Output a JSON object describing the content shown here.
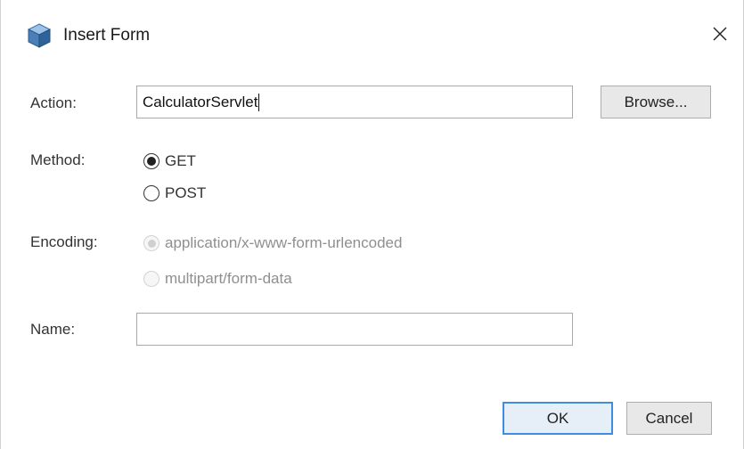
{
  "window": {
    "title": "Insert Form",
    "close_glyph": "×",
    "icon": "cube-icon"
  },
  "action": {
    "label": "Action:",
    "value": "CalculatorServlet",
    "browse_label": "Browse..."
  },
  "method": {
    "label": "Method:",
    "options": [
      {
        "label": "GET",
        "selected": true
      },
      {
        "label": "POST",
        "selected": false
      }
    ]
  },
  "encoding": {
    "label": "Encoding:",
    "enabled": false,
    "options": [
      {
        "label": "application/x-www-form-urlencoded",
        "selected": true
      },
      {
        "label": "multipart/form-data",
        "selected": false
      }
    ]
  },
  "name": {
    "label": "Name:",
    "value": ""
  },
  "buttons": {
    "ok": "OK",
    "cancel": "Cancel"
  },
  "colors": {
    "default_button_border": "#3d8ee0",
    "icon_blue": "#4a7fb8"
  }
}
